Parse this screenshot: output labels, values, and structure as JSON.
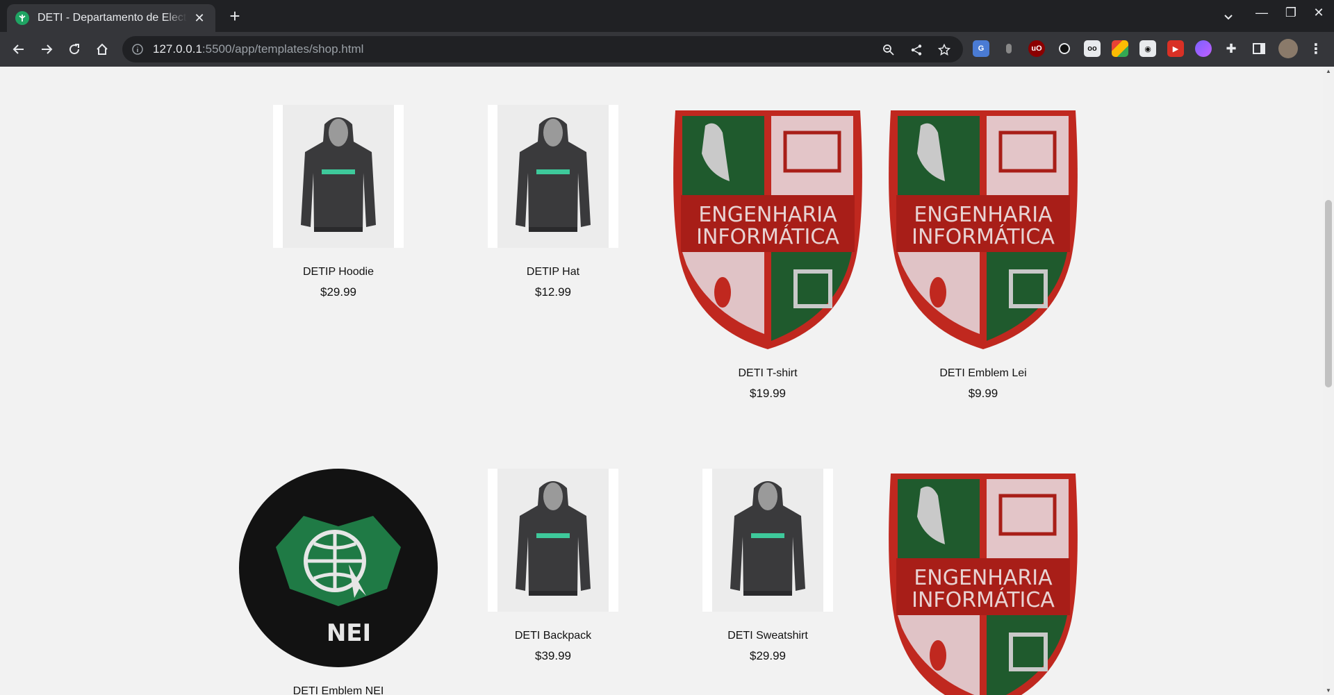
{
  "browser": {
    "tab_title": "DETI - Departamento de Electrónica",
    "tab_close": "✕",
    "new_tab": "+",
    "url_host": "127.0.0.1",
    "url_rest": ":5500/app/templates/shop.html",
    "window_controls": [
      "—",
      "❐",
      "✕"
    ]
  },
  "products": [
    {
      "name": "DETIP Hoodie",
      "price": "$29.99",
      "image": "hoodie"
    },
    {
      "name": "DETIP Hat",
      "price": "$12.99",
      "image": "hoodie"
    },
    {
      "name": "DETI T-shirt",
      "price": "$19.99",
      "image": "emblem-ei"
    },
    {
      "name": "DETI Emblem Lei",
      "price": "$9.99",
      "image": "emblem-ei"
    },
    {
      "name": "DETI Emblem NEI",
      "price": "",
      "image": "emblem-nei"
    },
    {
      "name": "DETI Backpack",
      "price": "$39.99",
      "image": "hoodie"
    },
    {
      "name": "DETI Sweatshirt",
      "price": "$29.99",
      "image": "hoodie"
    },
    {
      "name": "",
      "price": "",
      "image": "emblem-ei"
    }
  ],
  "emblem_text": {
    "line1": "ENGENHARIA",
    "line2": "INFORMÁTICA",
    "nei": "NEI"
  },
  "colors": {
    "page_bg": "#f2f2f2",
    "emblem_red": "#b3201c",
    "emblem_green": "#1f5a2d",
    "nei_green": "#1f7a45"
  }
}
